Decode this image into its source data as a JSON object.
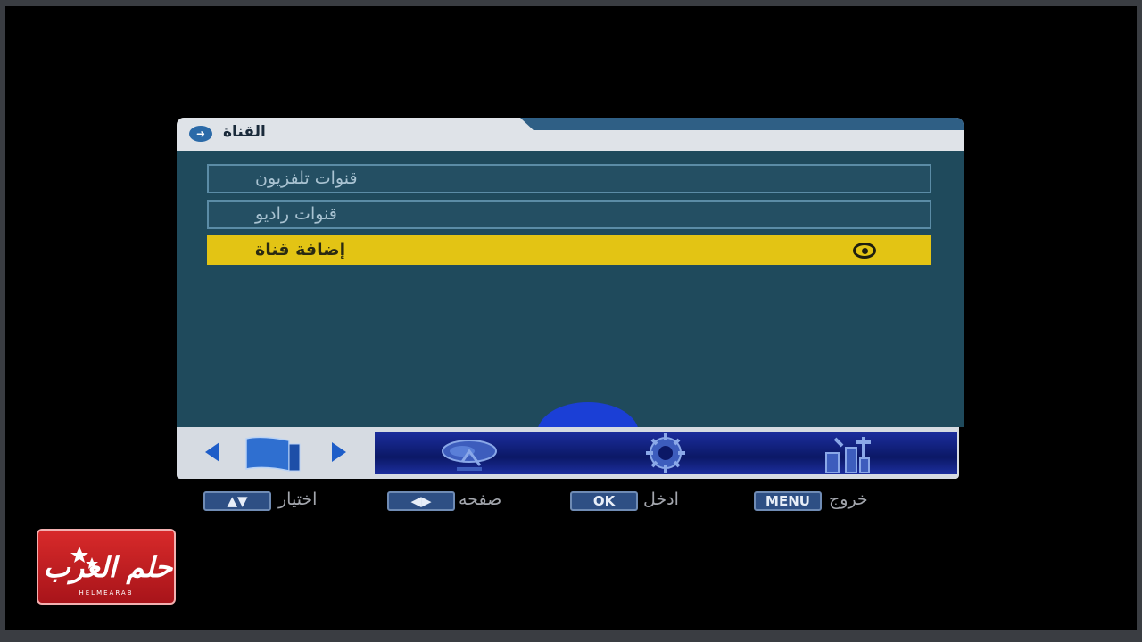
{
  "window": {
    "title": "القناة",
    "title_icon": "arrow-circle-icon"
  },
  "menu": {
    "items": [
      {
        "label": "قنوات تلفزيون",
        "selected": false
      },
      {
        "label": "قنوات راديو",
        "selected": false
      },
      {
        "label": "إضافة قناة",
        "selected": true
      }
    ]
  },
  "nav_bar": {
    "left_arrow_icon": "triangle-left-icon",
    "right_arrow_icon": "triangle-right-icon",
    "current_icon": "tv-icon",
    "icons": [
      "satellite-dish-icon",
      "gear-icon",
      "tools-icon"
    ]
  },
  "key_hints": [
    {
      "key": "▲▼",
      "label": "اختيار"
    },
    {
      "key": "◀▶",
      "label": "صفحه"
    },
    {
      "key": "OK",
      "label": "ادخل"
    },
    {
      "key": "MENU",
      "label": "خروج"
    }
  ],
  "logo": {
    "text": "حلم العرب",
    "subtext": "HELMEARAB"
  },
  "colors": {
    "panel": "#1f4a5c",
    "selected": "#e3c414",
    "nav_strip": "#0b1866",
    "logo": "#d82a2a",
    "cursor_highlight": "#1b3fd6"
  }
}
